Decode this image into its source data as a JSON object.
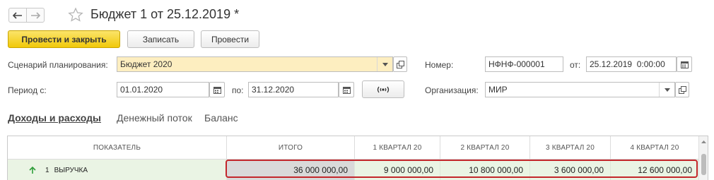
{
  "header": {
    "title": "Бюджет 1 от 25.12.2019 *"
  },
  "toolbar": {
    "post_close_label": "Провести и закрыть",
    "save_label": "Записать",
    "post_label": "Провести"
  },
  "form": {
    "scenario_label": "Сценарий планирования:",
    "scenario_value": "Бюджет 2020",
    "number_label": "Номер:",
    "number_value": "НФНФ-000001",
    "from_label": "от:",
    "date_value": "25.12.2019  0:00:00",
    "period_label": "Период с:",
    "period_from": "01.01.2020",
    "period_to_label": "по:",
    "period_to": "31.12.2020",
    "org_label": "Организация:",
    "org_value": "МИР"
  },
  "tabs": [
    "Доходы и расходы",
    "Денежный поток",
    "Баланс"
  ],
  "table": {
    "columns": [
      "ПОКАЗАТЕЛЬ",
      "ИТОГО",
      "1 КВАРТАЛ 20",
      "2 КВАРТАЛ 20",
      "3 КВАРТАЛ 20",
      "4 КВАРТАЛ 20"
    ],
    "row": {
      "num": "1",
      "name": "ВЫРУЧКА",
      "values": [
        "36 000 000,00",
        "9 000 000,00",
        "10 800 000,00",
        "3 600 000,00",
        "12 600 000,00"
      ]
    }
  },
  "colors": {
    "accent": "#f1c90a",
    "highlight": "#c3272b",
    "row_bg": "#eaf4e4",
    "arrow": "#2f9e3a"
  }
}
